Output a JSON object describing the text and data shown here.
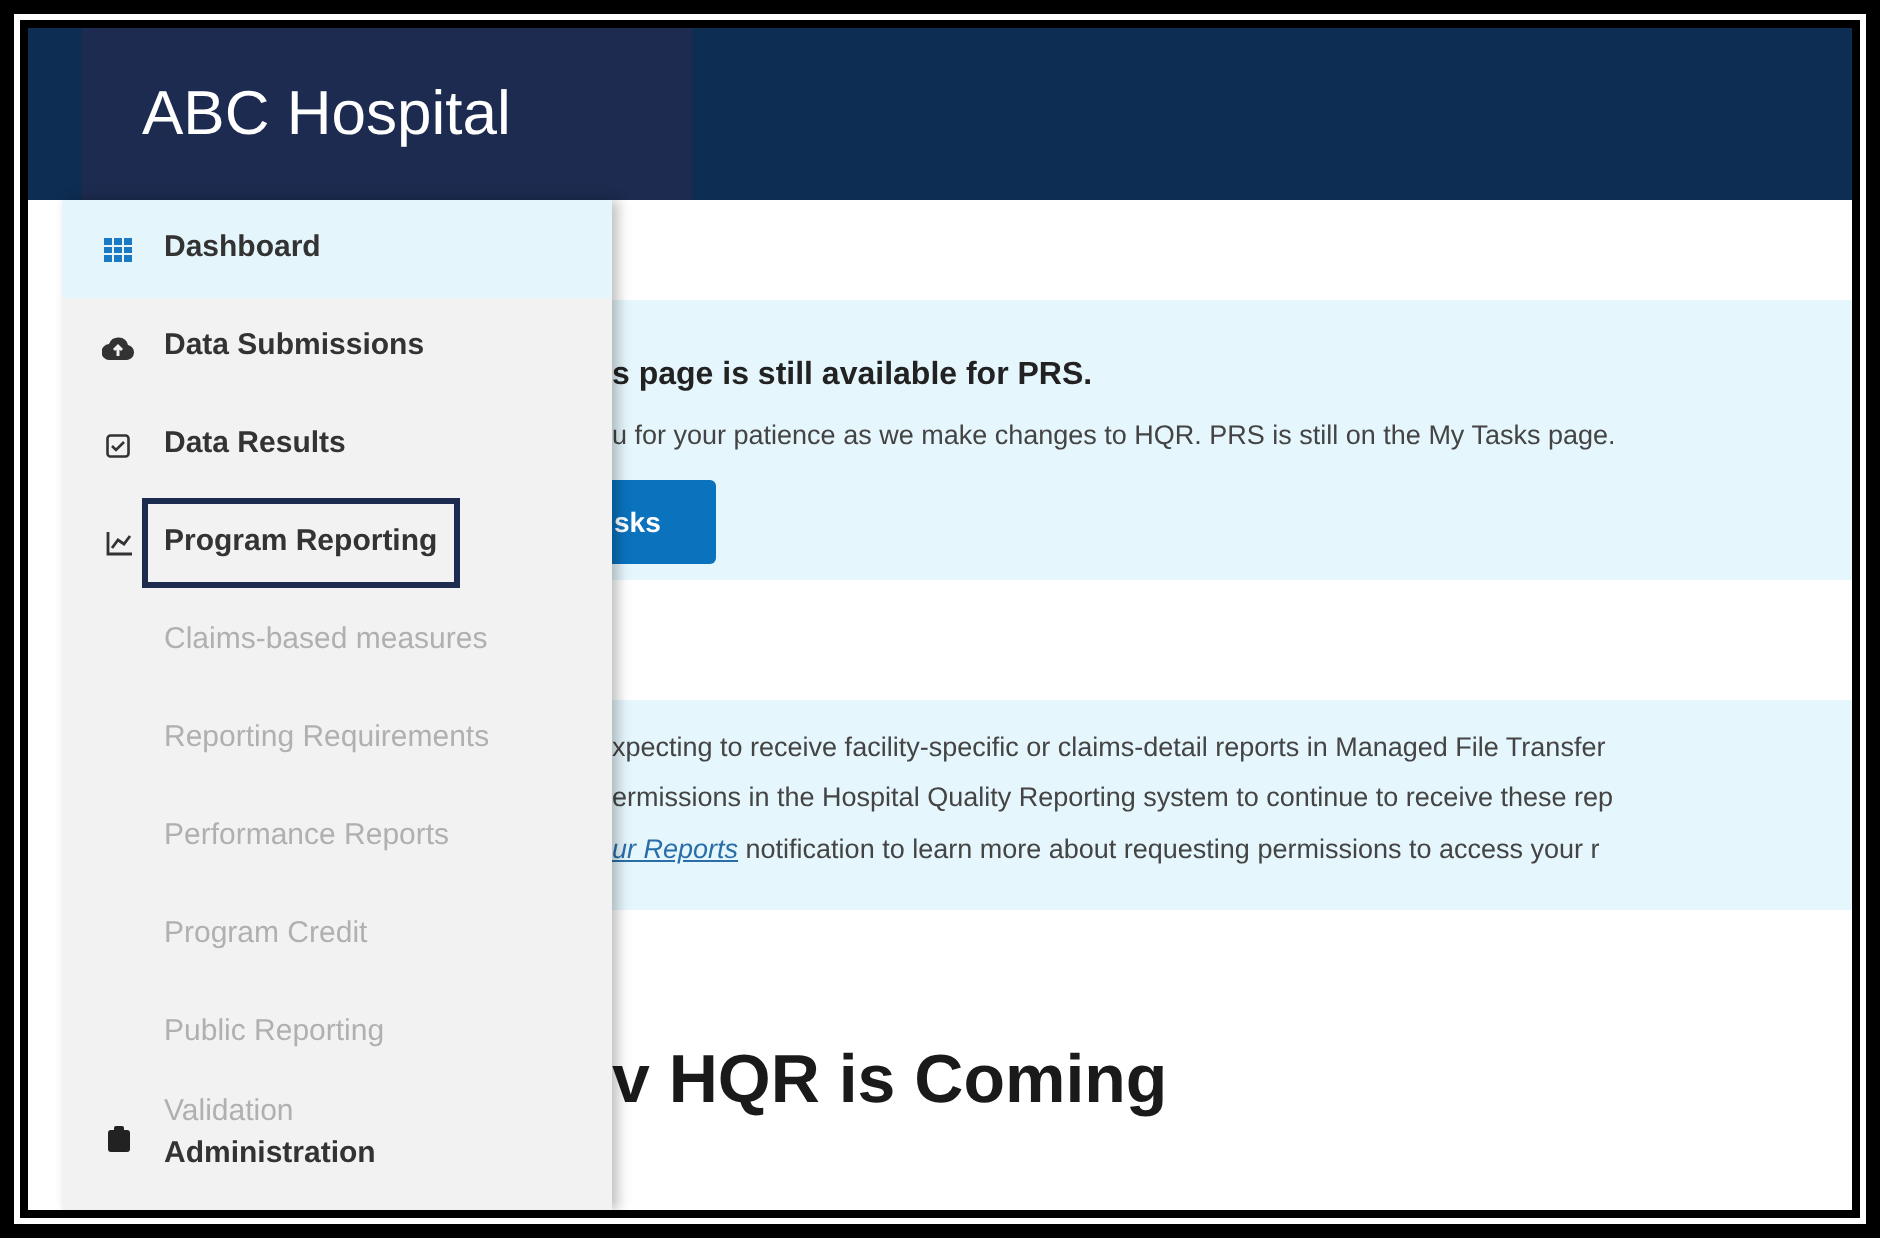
{
  "header": {
    "title": "ABC Hospital"
  },
  "sidebar": {
    "items": [
      {
        "kind": "main",
        "label": "Dashboard",
        "selected": true,
        "focused": false
      },
      {
        "kind": "main",
        "label": "Data Submissions",
        "selected": false,
        "focused": false
      },
      {
        "kind": "main",
        "label": "Data Results",
        "selected": false,
        "focused": false
      },
      {
        "kind": "main",
        "label": "Program Reporting",
        "selected": false,
        "focused": true
      },
      {
        "kind": "sub",
        "label": "Claims-based measures",
        "selected": false,
        "focused": false
      },
      {
        "kind": "sub",
        "label": "Reporting Requirements",
        "selected": false,
        "focused": false
      },
      {
        "kind": "sub",
        "label": "Performance Reports",
        "selected": false,
        "focused": false
      },
      {
        "kind": "sub",
        "label": "Program Credit",
        "selected": false,
        "focused": false
      },
      {
        "kind": "sub",
        "label": "Public Reporting",
        "selected": false,
        "focused": false
      },
      {
        "kind": "sub",
        "label": "Validation",
        "selected": false,
        "focused": false
      },
      {
        "kind": "main",
        "label": "Administration",
        "selected": false,
        "focused": false
      }
    ]
  },
  "banners": [
    {
      "title": "s page is still available for PRS.",
      "lines": [
        "u for your patience as we make changes to HQR. PRS is still on the My Tasks page."
      ],
      "button": "sks"
    },
    {
      "lines": [
        "xpecting to receive facility-specific or claims-detail reports in Managed File Transfer",
        "ermissions in the Hospital Quality Reporting system to continue to receive these rep"
      ],
      "link": "ur Reports",
      "link_tail": " notification to learn more about requesting permissions to access your r"
    }
  ],
  "heading": "v HQR is Coming"
}
